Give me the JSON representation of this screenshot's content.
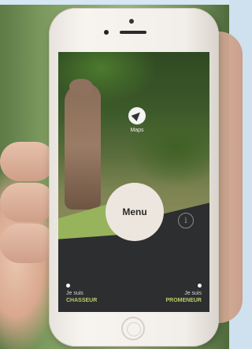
{
  "main": {
    "maps_label": "Maps",
    "menu_label": "Menu",
    "info_icon_glyph": "i"
  },
  "choices": {
    "left": {
      "line1": "Je suis",
      "line2": "CHASSEUR"
    },
    "right": {
      "line1": "Je suis",
      "line2": "PROMENEUR"
    }
  },
  "icons": [
    "maps-icon",
    "info-icon",
    "home-button"
  ],
  "colors": {
    "accent_green": "#97b35c",
    "label_green": "#b7cf6a",
    "dark_panel": "#2d2e30",
    "menu_circle": "#ece6df"
  }
}
